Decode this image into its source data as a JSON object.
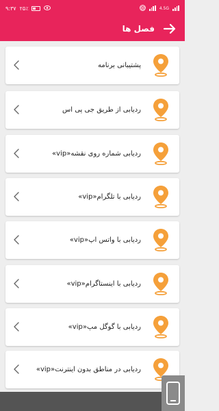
{
  "status_bar": {
    "time": "۹:۳۷",
    "battery": "۲۵٪",
    "network": "4.5G"
  },
  "app_bar": {
    "title": "فصل ها"
  },
  "items": [
    {
      "label": "پشتیبانی برنامه"
    },
    {
      "label": "ردیابی از طریق جی پی اس"
    },
    {
      "label": "ردیابی شماره روی نقشه«vip»"
    },
    {
      "label": "ردیابی با تلگرام«vip»"
    },
    {
      "label": "ردیابی با واتس اپ«vip»"
    },
    {
      "label": "ردیابی با اینستاگرام«vip»"
    },
    {
      "label": "ردیابی با گوگل مپ«vip»"
    },
    {
      "label": "ردیابی در مناطق بدون اینترنت«vip»"
    }
  ],
  "colors": {
    "primary": "#e8245b",
    "pin": "#f5a03a",
    "background": "#eeeeee",
    "bottom_bar": "#545454"
  },
  "icons": {
    "back": "arrow-right-icon",
    "item_leading": "map-pin-icon",
    "item_trailing": "chevron-left-icon"
  }
}
